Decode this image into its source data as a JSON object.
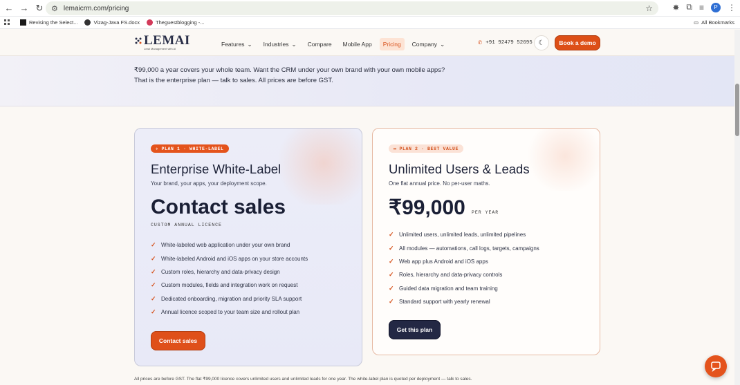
{
  "browser": {
    "url": "lemaicrm.com/pricing",
    "profile_initial": "P",
    "bookmarks": [
      "Revising the Select...",
      "Vizag-Java FS.docx",
      "Theguestblogging -..."
    ],
    "all_bookmarks_label": "All Bookmarks"
  },
  "header": {
    "logo_text": "LEMAI",
    "logo_tagline": "Lead Management with AI",
    "nav": [
      {
        "label": "Features",
        "dropdown": true
      },
      {
        "label": "Industries",
        "dropdown": true
      },
      {
        "label": "Compare",
        "dropdown": false
      },
      {
        "label": "Mobile App",
        "dropdown": false
      },
      {
        "label": "Pricing",
        "dropdown": false,
        "active": true
      },
      {
        "label": "Company",
        "dropdown": true
      }
    ],
    "phone": "+91 92479 52695",
    "demo_button": "Book a demo"
  },
  "hero": {
    "line1": "₹99,000 a year covers your whole team. Want the CRM under your own brand with your own mobile apps?",
    "line2": "That is the enterprise plan — talk to sales. All prices are before GST."
  },
  "plans": [
    {
      "badge": "PLAN 1 · WHITE-LABEL",
      "title": "Enterprise White-Label",
      "subtitle": "Your brand, your apps, your deployment scope.",
      "price": "Contact sales",
      "price_note": "CUSTOM ANNUAL LICENCE",
      "features": [
        "White-labeled web application under your own brand",
        "White-labeled Android and iOS apps on your store accounts",
        "Custom roles, hierarchy and data-privacy design",
        "Custom modules, fields and integration work on request",
        "Dedicated onboarding, migration and priority SLA support",
        "Annual licence scoped to your team size and rollout plan"
      ],
      "button": "Contact sales"
    },
    {
      "badge": "PLAN 2 · BEST VALUE",
      "title": "Unlimited Users & Leads",
      "subtitle": "One flat annual price. No per-user maths.",
      "price": "₹99,000",
      "price_suffix": "PER YEAR",
      "features": [
        "Unlimited users, unlimited leads, unlimited pipelines",
        "All modules — automations, call logs, targets, campaigns",
        "Web app plus Android and iOS apps",
        "Roles, hierarchy and data-privacy controls",
        "Guided data migration and team training",
        "Standard support with yearly renewal"
      ],
      "button": "Get this plan"
    }
  ],
  "footnote": "All prices are before GST. The flat ₹99,000 licence covers unlimited users and unlimited leads for one year. The white-label plan is quoted per deployment — talk to sales.",
  "colors": {
    "accent": "#df501a",
    "navy": "#232844",
    "hero_bg": "#e7e8f6"
  }
}
